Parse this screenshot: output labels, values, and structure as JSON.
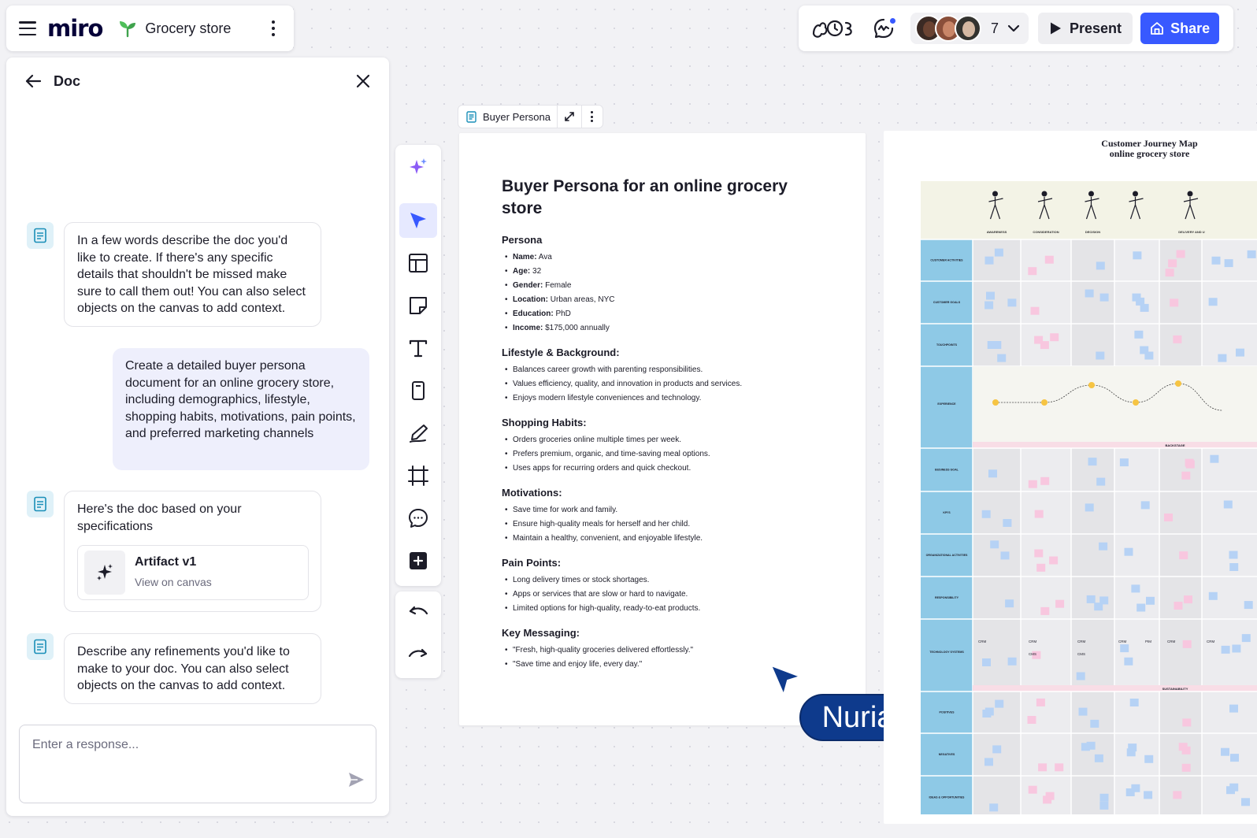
{
  "topbar": {
    "logo": "miro",
    "board_name": "Grocery store",
    "collaborator_count": "7",
    "present_label": "Present",
    "share_label": "Share"
  },
  "side_panel": {
    "title": "Doc",
    "messages": [
      {
        "from": "assistant",
        "text": "In a few words describe the doc you'd like to create. If there's any specific details that shouldn't be missed make sure to call them out! You can also select objects on the canvas to add context."
      },
      {
        "from": "user",
        "text": "Create a detailed buyer persona document for an online grocery store, including demographics, lifestyle, shopping habits, motivations, pain points, and preferred marketing channels"
      },
      {
        "from": "assistant",
        "text": "Here's the doc based on your specifications"
      },
      {
        "from": "assistant",
        "text": "Describe any refinements you'd like to make to your doc. You can also select objects on the canvas to add context."
      }
    ],
    "artifact": {
      "title": "Artifact v1",
      "subtitle": "View on canvas"
    },
    "input_placeholder": "Enter a response..."
  },
  "doc_frame": {
    "label": "Buyer Persona",
    "title": "Buyer Persona for an online grocery store",
    "sections": [
      {
        "heading": "Persona",
        "items": [
          {
            "key": "Name:",
            "value": " Ava"
          },
          {
            "key": "Age:",
            "value": " 32"
          },
          {
            "key": "Gender:",
            "value": " Female"
          },
          {
            "key": "Location:",
            "value": " Urban areas, NYC"
          },
          {
            "key": "Education:",
            "value": " PhD"
          },
          {
            "key": "Income:",
            "value": " $175,000 annually"
          }
        ]
      },
      {
        "heading": "Lifestyle & Background:",
        "items": [
          {
            "key": "",
            "value": "Balances career growth with parenting responsibilities."
          },
          {
            "key": "",
            "value": "Values efficiency, quality, and innovation in products and services."
          },
          {
            "key": "",
            "value": "Enjoys modern lifestyle conveniences and technology."
          }
        ]
      },
      {
        "heading": "Shopping Habits:",
        "items": [
          {
            "key": "",
            "value": "Orders groceries online multiple times per week."
          },
          {
            "key": "",
            "value": "Prefers premium, organic, and time-saving meal options."
          },
          {
            "key": "",
            "value": "Uses apps for recurring orders and quick checkout."
          }
        ]
      },
      {
        "heading": "Motivations:",
        "items": [
          {
            "key": "",
            "value": "Save time for work and family."
          },
          {
            "key": "",
            "value": "Ensure high-quality meals for herself and her child."
          },
          {
            "key": "",
            "value": "Maintain a healthy, convenient, and enjoyable lifestyle."
          }
        ]
      },
      {
        "heading": "Pain Points:",
        "items": [
          {
            "key": "",
            "value": "Long delivery times or stock shortages."
          },
          {
            "key": "",
            "value": "Apps or services that are slow or hard to navigate."
          },
          {
            "key": "",
            "value": "Limited options for high-quality, ready-to-eat products."
          }
        ]
      },
      {
        "heading": "Key Messaging:",
        "items": [
          {
            "key": "",
            "value": "\"Fresh, high-quality groceries delivered effortlessly.\""
          },
          {
            "key": "",
            "value": "\"Save time and enjoy life, every day.\""
          }
        ]
      }
    ]
  },
  "cursor": {
    "name": "Nuria"
  },
  "journey_map": {
    "title_line1": "Customer Journey Map",
    "title_line2": "online grocery store",
    "stages": [
      "AWARENESS",
      "CONSIDERATION",
      "DECISION",
      "",
      "DELIVERY AND U"
    ],
    "rows": [
      "CUSTOMER ACTIVITIES",
      "CUSTOMER GOALS",
      "TOUCHPOINTS",
      "EXPERIENCE",
      "BUSINESS GOAL",
      "KPI'S",
      "ORGANIZATIONAL ACTIVITIES",
      "RESPONSIBILITY",
      "TECHNOLOGY SYSTEMS",
      "POSITIVES",
      "NEGATIVES",
      "IDEAS & OPPORTUNITIES"
    ],
    "band_labels": [
      "BACKSTAGE",
      "SUSTAINABILITY"
    ],
    "tech_labels": [
      "CRM",
      "CMS",
      "PIM"
    ]
  },
  "colors": {
    "accent": "#3859ff",
    "cursor_bg": "#0e3a8c",
    "user_bubble": "#eeeffc",
    "map_label_col": "#8ec9e6",
    "map_header": "#f3f3e6",
    "map_band": "#f8dde6",
    "sticky_blue": "#b6d2f5",
    "sticky_pink": "#f8c7df"
  }
}
